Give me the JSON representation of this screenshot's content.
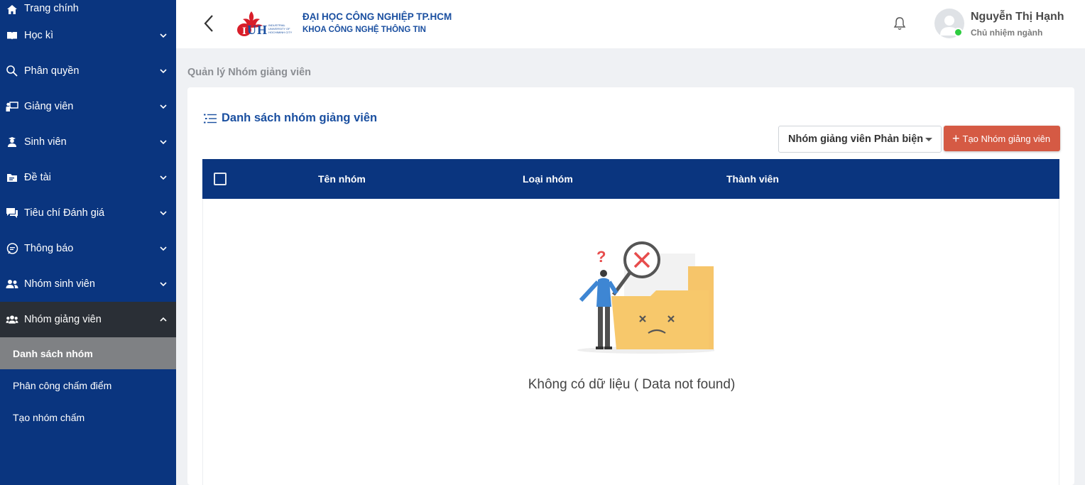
{
  "sidebar": {
    "items": [
      {
        "label": "Trang chính",
        "icon": "home-icon"
      },
      {
        "label": "Học kì",
        "icon": "book-icon"
      },
      {
        "label": "Phân quyền",
        "icon": "key-search-icon"
      },
      {
        "label": "Giảng viên",
        "icon": "teacher-icon"
      },
      {
        "label": "Sinh viên",
        "icon": "student-icon"
      },
      {
        "label": "Đề tài",
        "icon": "folder-icon"
      },
      {
        "label": "Tiêu chí Đánh giá",
        "icon": "chat-icon"
      },
      {
        "label": "Thông báo",
        "icon": "message-icon"
      },
      {
        "label": "Nhóm sinh viên",
        "icon": "users-icon"
      },
      {
        "label": "Nhóm giảng viên",
        "icon": "group-icon"
      }
    ],
    "sub_items": [
      {
        "label": "Danh sách nhóm"
      },
      {
        "label": "Phân công chấm điểm"
      },
      {
        "label": "Tạo nhóm chấm"
      }
    ]
  },
  "header": {
    "university": "ĐẠI HỌC CÔNG NGHIỆP TP.HCM",
    "faculty": "KHOA CÔNG NGHỆ THÔNG TIN",
    "user_name": "Nguyễn Thị Hạnh",
    "user_role": "Chủ nhiệm ngành",
    "logo_text": "IUH INDUSTRIAL UNIVERSITY OF HOCHIMINH CITY"
  },
  "breadcrumb": "Quản lý Nhóm giảng viên",
  "card": {
    "title": "Danh sách nhóm giảng viên",
    "filter_value": "Nhóm giảng viên Phản biện",
    "create_label": "Tạo Nhóm giảng viên",
    "columns": [
      "Tên nhóm",
      "Loại nhóm",
      "Thành viên"
    ],
    "empty_text": "Không có dữ liệu ( Data not found)"
  },
  "colors": {
    "sidebar_bg": "#0a357f",
    "active_item_bg": "#2a2f36",
    "active_sub_bg": "#7f8184",
    "brand_text": "#1a4fa0",
    "create_button": "#d55a44",
    "online": "#2ecc40"
  }
}
